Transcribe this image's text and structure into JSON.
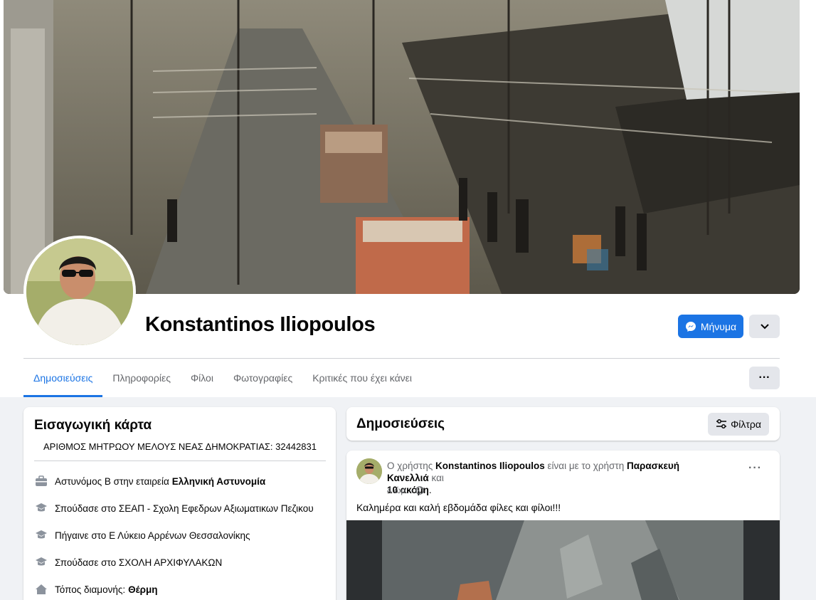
{
  "profile": {
    "name": "Konstantinos Iliopoulos",
    "message_button": "Μήνυμα"
  },
  "tabs": [
    {
      "label": "Δημοσιεύσεις",
      "active": true
    },
    {
      "label": "Πληροφορίες",
      "active": false
    },
    {
      "label": "Φίλοι",
      "active": false
    },
    {
      "label": "Φωτογραφίες",
      "active": false
    },
    {
      "label": "Κριτικές που έχει κάνει",
      "active": false
    }
  ],
  "tab_more": "···",
  "intro": {
    "title": "Εισαγωγική κάρτα",
    "bio": "ΑΡΙΘΜΟΣ ΜΗΤΡΩΟΥ ΜΕΛΟΥΣ ΝΕΑΣ ΔΗΜΟΚΡΑΤΙΑΣ: 32442831",
    "items": [
      {
        "icon": "briefcase-icon",
        "text": "Αστυνόμος Β στην εταιρεία",
        "bold": "Ελληνική Αστυνομία"
      },
      {
        "icon": "graduation-cap-icon",
        "text": "Σπούδασε στο ΣΕΑΠ - Σχολη Εφεδρων Αξιωματικων Πεζικου",
        "bold": ""
      },
      {
        "icon": "graduation-cap-icon",
        "text": "Πήγαινε στο Ε Λύκειο Αρρένων Θεσσαλονίκης",
        "bold": ""
      },
      {
        "icon": "graduation-cap-icon",
        "text": "Σπούδασε στο ΣΧΟΛΗ ΑΡΧΙΦΥΛΑΚΩΝ",
        "bold": ""
      },
      {
        "icon": "home-icon",
        "text": "Τόπος διαμονής:",
        "bold": "Θέρμη"
      }
    ]
  },
  "posts_section": {
    "title": "Δημοσιεύσεις",
    "filters_button": "Φίλτρα"
  },
  "post": {
    "prefix": "Ο χρήστης",
    "author": "Konstantinos Iliopoulos",
    "with_text": "είναι με το χρήστη",
    "tagged": "Παρασκευή Κανελλιά",
    "and_text": "και",
    "others": "10 ακόμη",
    "time": "4 ώρ. ·",
    "body": "Καλημέρα και καλή εβδομάδα φίλες και φίλοι!!!"
  },
  "colors": {
    "accent": "#1b74e4",
    "background": "#f0f2f5",
    "secondary_text": "#65676b"
  }
}
